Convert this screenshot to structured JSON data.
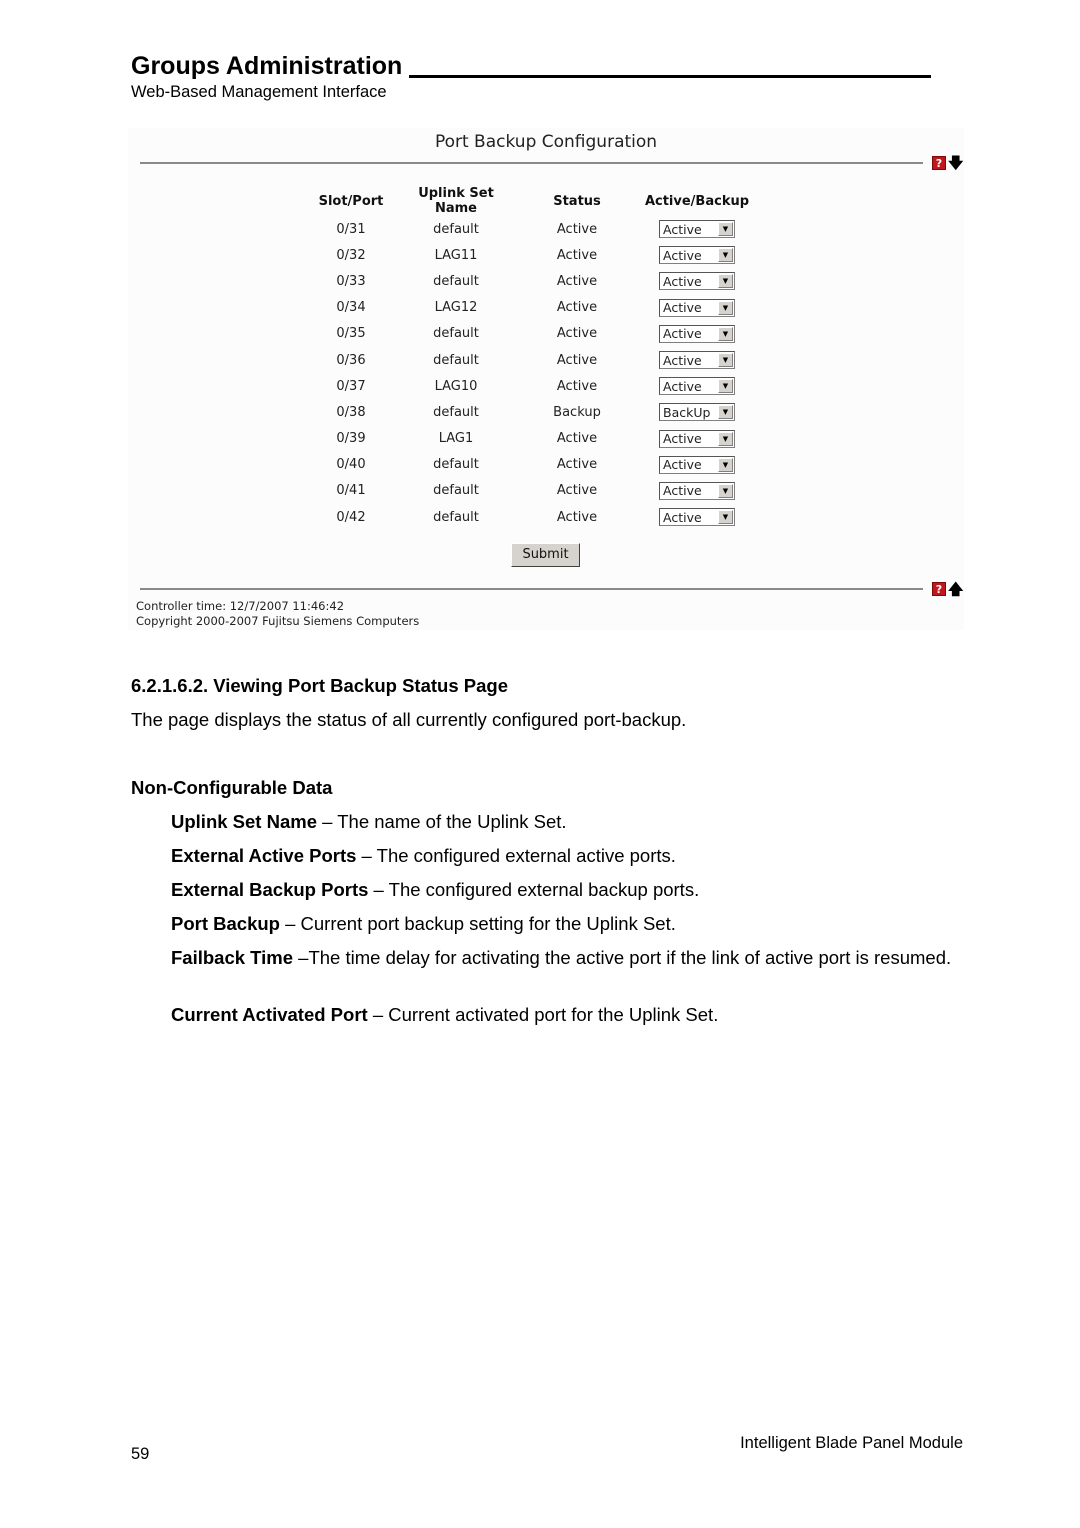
{
  "header": {
    "title": "Groups Administration",
    "subtitle": "Web-Based Management Interface"
  },
  "screenshot": {
    "title": "Port Backup Configuration",
    "help_icon_glyph": "?",
    "down_arrow_glyph": "🡇",
    "up_arrow_glyph": "🡅",
    "columns": [
      "Slot/Port",
      "Uplink Set Name",
      "Status",
      "Active/Backup"
    ],
    "rows": [
      {
        "port": "0/31",
        "uplink": "default",
        "status": "Active",
        "mode": "Active"
      },
      {
        "port": "0/32",
        "uplink": "LAG11",
        "status": "Active",
        "mode": "Active"
      },
      {
        "port": "0/33",
        "uplink": "default",
        "status": "Active",
        "mode": "Active"
      },
      {
        "port": "0/34",
        "uplink": "LAG12",
        "status": "Active",
        "mode": "Active"
      },
      {
        "port": "0/35",
        "uplink": "default",
        "status": "Active",
        "mode": "Active"
      },
      {
        "port": "0/36",
        "uplink": "default",
        "status": "Active",
        "mode": "Active"
      },
      {
        "port": "0/37",
        "uplink": "LAG10",
        "status": "Active",
        "mode": "Active"
      },
      {
        "port": "0/38",
        "uplink": "default",
        "status": "Backup",
        "mode": "BackUp"
      },
      {
        "port": "0/39",
        "uplink": "LAG1",
        "status": "Active",
        "mode": "Active"
      },
      {
        "port": "0/40",
        "uplink": "default",
        "status": "Active",
        "mode": "Active"
      },
      {
        "port": "0/41",
        "uplink": "default",
        "status": "Active",
        "mode": "Active"
      },
      {
        "port": "0/42",
        "uplink": "default",
        "status": "Active",
        "mode": "Active"
      }
    ],
    "dropdown_arrow_glyph": "▼",
    "submit_label": "Submit",
    "controller_time": "Controller time: 12/7/2007 11:46:42",
    "copyright": "Copyright 2000-2007 Fujitsu Siemens Computers"
  },
  "section": {
    "heading": "6.2.1.6.2. Viewing Port Backup Status Page",
    "intro": "The page displays the status of all currently configured port-backup.",
    "subheading": "Non-Configurable Data",
    "definitions": [
      {
        "term": "Uplink Set Name",
        "desc": " – The name of the Uplink Set."
      },
      {
        "term": "External Active Ports",
        "desc": " – The configured external active ports."
      },
      {
        "term": "External Backup Ports",
        "desc": " – The configured external backup ports."
      },
      {
        "term": "Port Backup",
        "desc": " – Current port backup setting for the Uplink Set."
      },
      {
        "term": "Failback Time",
        "desc": " –The time delay for activating the active port if the link of active port is resumed."
      },
      {
        "term": "Current Activated Port",
        "desc": " – Current activated port for the Uplink Set."
      }
    ]
  },
  "footer": {
    "page_number": "59",
    "product": "Intelligent Blade Panel Module"
  }
}
